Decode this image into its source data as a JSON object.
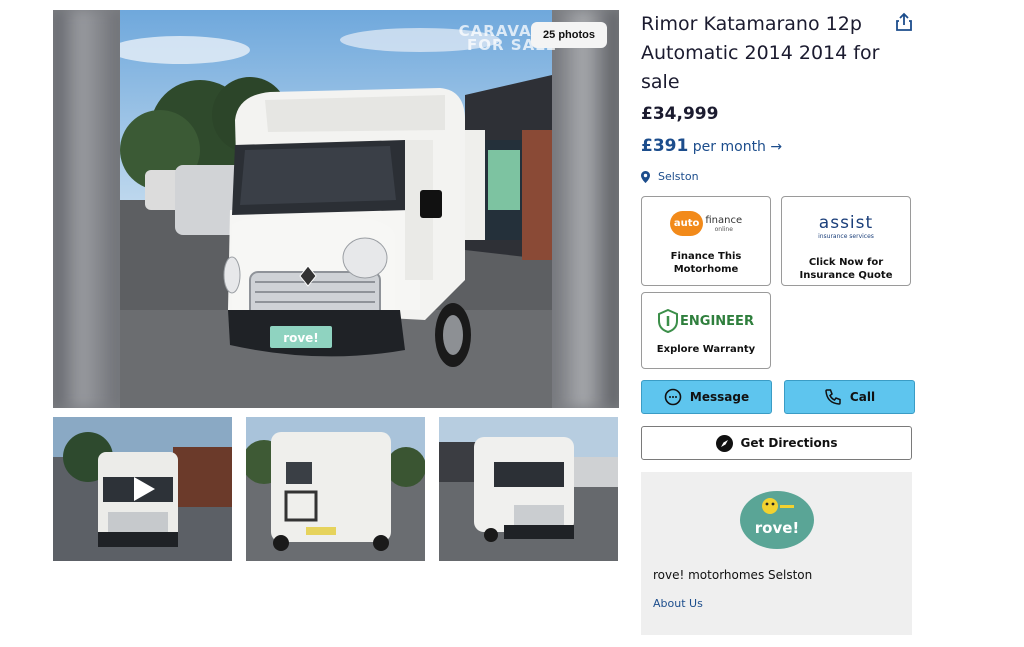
{
  "listing": {
    "title": "Rimor Katamarano 12p Automatic 2014 2014 for sale",
    "price": "£34,999",
    "monthly_amount": "£391",
    "monthly_suffix": "per month →",
    "location": "Selston"
  },
  "gallery": {
    "photo_count": "25 photos",
    "watermark": "CARAVANS FOR SALE",
    "plate_text": "rove!"
  },
  "cards": {
    "finance": {
      "logo_a": "auto",
      "logo_b": "finance",
      "logo_sub": "online",
      "label": "Finance This Motorhome"
    },
    "insurance": {
      "logo": "assist",
      "logo_sub": "insurance services",
      "label": "Click Now for Insurance Quote"
    },
    "warranty": {
      "logo": "ENGINEER",
      "label": "Explore Warranty"
    }
  },
  "actions": {
    "message": "Message",
    "call": "Call",
    "directions": "Get Directions"
  },
  "dealer": {
    "logo_text": "rove!",
    "name": "rove! motorhomes Selston",
    "about": "About Us"
  },
  "colors": {
    "accent_blue": "#5ec5ee",
    "link_blue": "#1c4d8c",
    "dealer_logo_bg": "#5aa596"
  }
}
